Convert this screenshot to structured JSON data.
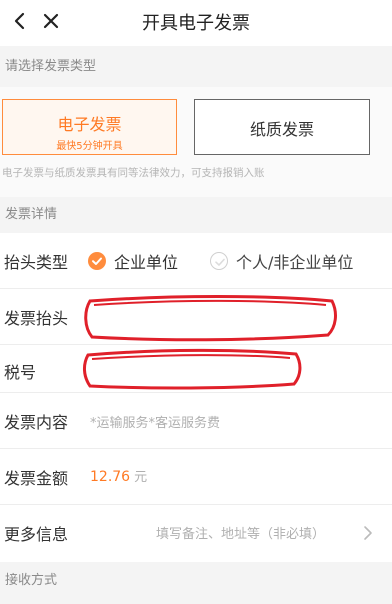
{
  "header": {
    "title": "开具电子发票",
    "back_icon": "chevron-left-icon",
    "close_icon": "close-icon"
  },
  "sections": {
    "invoice_type_title": "请选择发票类型",
    "invoice_detail_title": "发票详情",
    "receive_method_title": "接收方式"
  },
  "invoice_type": {
    "electronic_label": "电子发票",
    "electronic_sub": "最快5分钟开具",
    "paper_label": "纸质发票",
    "note": "电子发票与纸质发票具有同等法律效力，可支持报销入账",
    "selected": "电子发票"
  },
  "detail": {
    "title_type_label": "抬头类型",
    "title_type_options": [
      "企业单位",
      "个人/非企业单位"
    ],
    "title_type_selected": "企业单位",
    "invoice_title_label": "发票抬头",
    "tax_no_label": "税号",
    "content_label": "发票内容",
    "content_value": "*运输服务*客运服务费",
    "amount_label": "发票金额",
    "amount_value": "12.76",
    "amount_unit": "元",
    "more_label": "更多信息",
    "more_placeholder": "填写备注、地址等（非必填）"
  },
  "colors": {
    "accent": "#ff7a24",
    "annotation_red": "#e0202a",
    "section_bg": "#f4f4f4"
  }
}
